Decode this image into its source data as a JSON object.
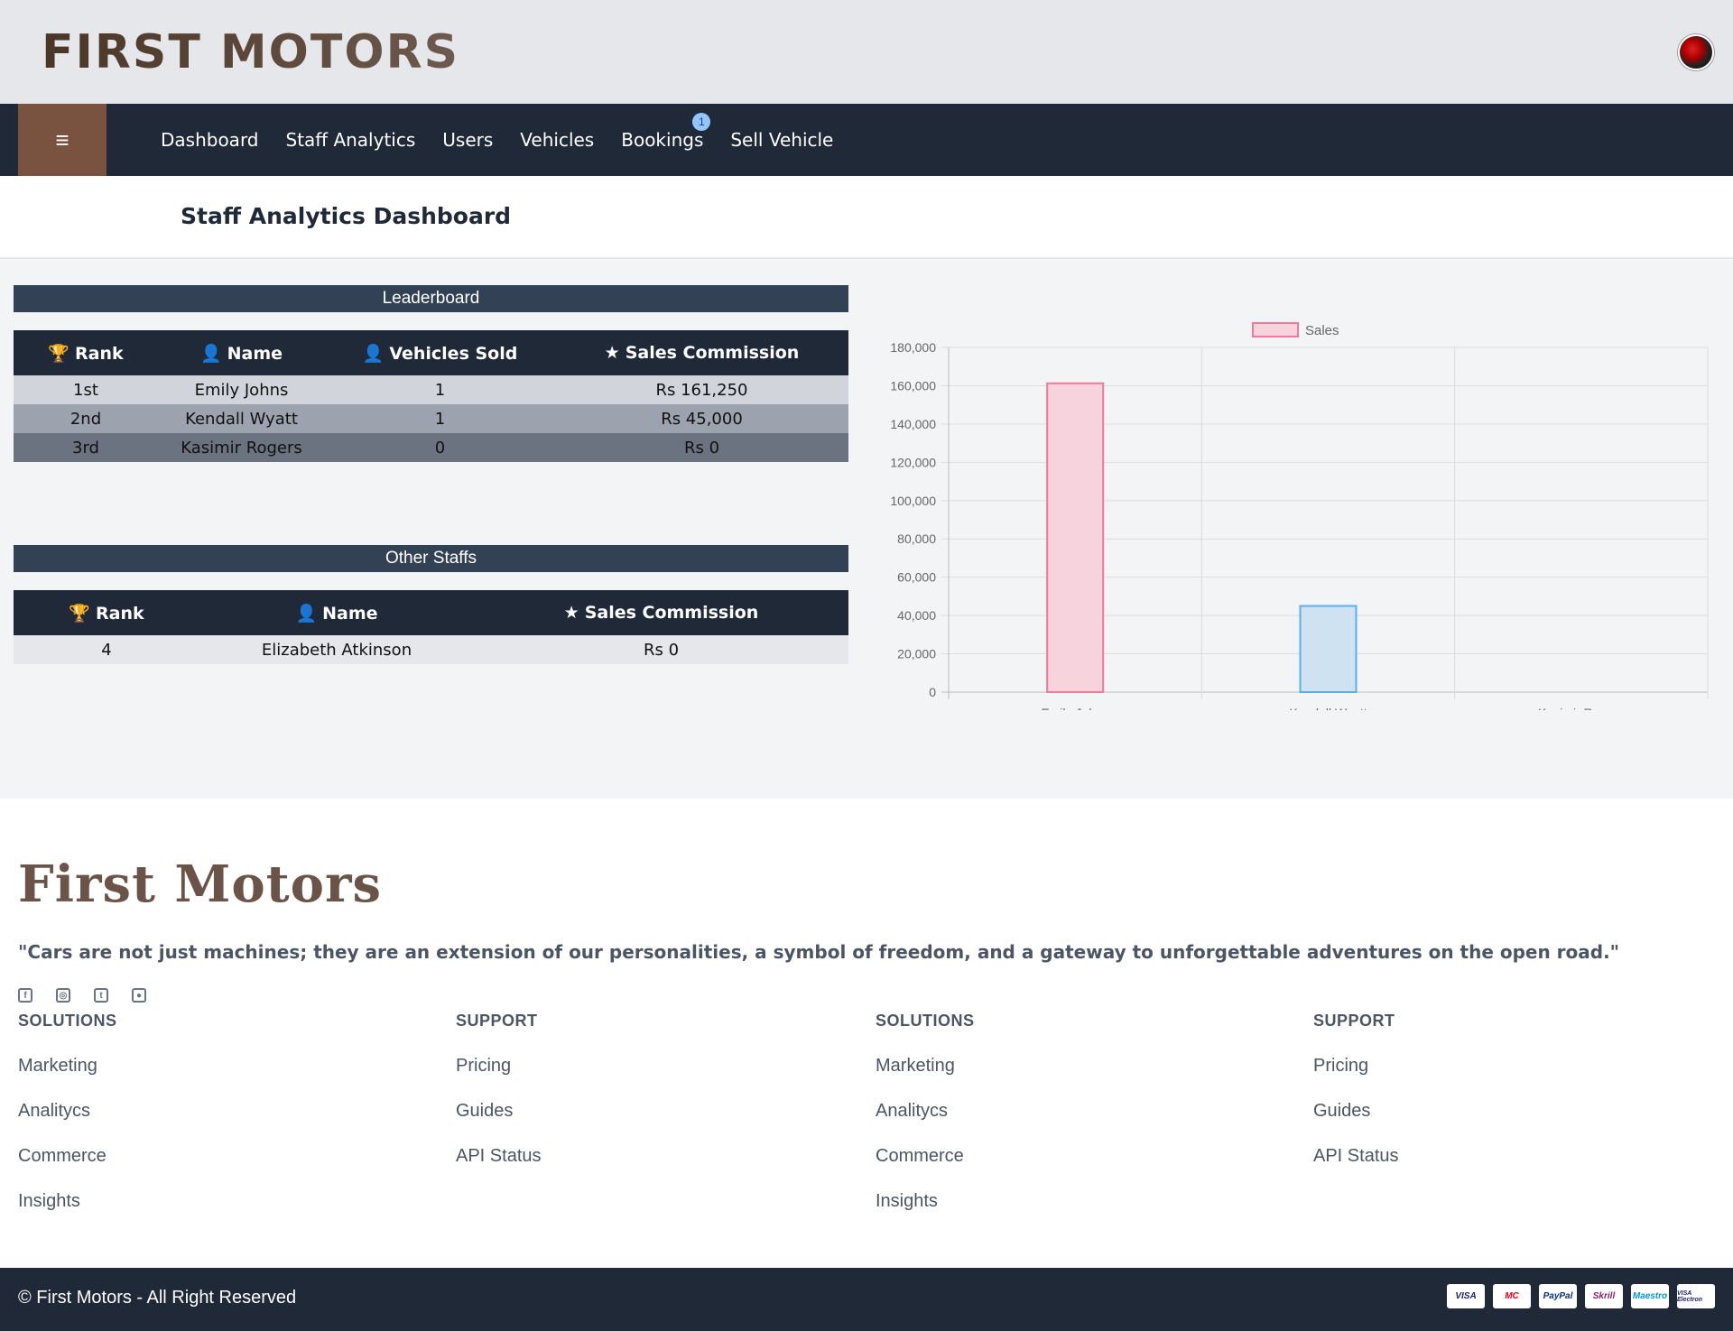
{
  "header": {
    "brand": "FIRST MOTORS"
  },
  "nav": {
    "menu_icon": "≡",
    "links": [
      "Dashboard",
      "Staff Analytics",
      "Users",
      "Vehicles",
      "Bookings",
      "Sell Vehicle"
    ],
    "bookings_badge": "1"
  },
  "page_title": "Staff Analytics Dashboard",
  "leaderboard": {
    "title": "Leaderboard",
    "headers": [
      "Rank",
      "Name",
      "Vehicles Sold",
      "Sales Commission"
    ],
    "rows": [
      [
        "1st",
        "Emily Johns",
        "1",
        "Rs 161,250"
      ],
      [
        "2nd",
        "Kendall Wyatt",
        "1",
        "Rs 45,000"
      ],
      [
        "3rd",
        "Kasimir Rogers",
        "0",
        "Rs 0"
      ]
    ]
  },
  "other_staffs": {
    "title": "Other Staffs",
    "headers": [
      "Rank",
      "Name",
      "Sales Commission"
    ],
    "rows": [
      [
        "4",
        "Elizabeth Atkinson",
        "Rs 0"
      ]
    ]
  },
  "chart_data": {
    "type": "bar",
    "categories": [
      "Emily Johns",
      "Kendall Wyatt",
      "Kasimir Rogers"
    ],
    "series": [
      {
        "name": "Sales",
        "values": [
          161250,
          45000,
          0
        ]
      }
    ],
    "bar_fill_colors": [
      "#f7d4dd",
      "#cfe2f2",
      "#fff5d6"
    ],
    "bar_stroke_colors": [
      "#f27999",
      "#5aaee8",
      "#ffd166"
    ],
    "ylim": [
      0,
      180000
    ],
    "yticks": [
      "0",
      "20,000",
      "40,000",
      "60,000",
      "80,000",
      "100,000",
      "120,000",
      "140,000",
      "160,000",
      "180,000"
    ],
    "legend": "top",
    "grid": true
  },
  "footer": {
    "brand": "First Motors",
    "quote": "\"Cars are not just machines; they are an extension of our personalities, a symbol of freedom, and a gateway to unforgettable adventures on the open road.\"",
    "social_icons": [
      "facebook-icon",
      "instagram-icon",
      "twitter-icon",
      "github-icon"
    ],
    "columns": [
      {
        "heading": "SOLUTIONS",
        "links": [
          "Marketing",
          "Analitycs",
          "Commerce",
          "Insights"
        ]
      },
      {
        "heading": "SUPPORT",
        "links": [
          "Pricing",
          "Guides",
          "API Status"
        ]
      },
      {
        "heading": "SOLUTIONS",
        "links": [
          "Marketing",
          "Analitycs",
          "Commerce",
          "Insights"
        ]
      },
      {
        "heading": "SUPPORT",
        "links": [
          "Pricing",
          "Guides",
          "API Status"
        ]
      }
    ],
    "copyright": "© First Motors - All Right Reserved",
    "payments": [
      "VISA",
      "MC",
      "PayPal",
      "Skrill",
      "Maestro",
      "VISA Electron"
    ]
  }
}
